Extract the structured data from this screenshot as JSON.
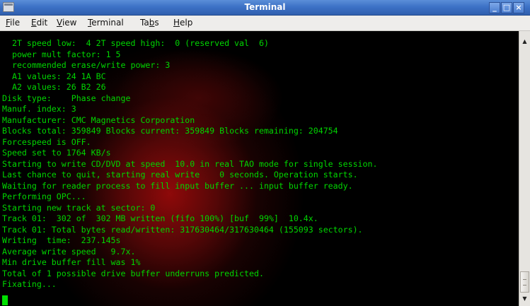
{
  "window": {
    "title": "Terminal",
    "minimize_glyph": "_",
    "maximize_glyph": "□",
    "close_glyph": "×"
  },
  "menubar": {
    "items": [
      {
        "mnemonic": "F",
        "rest": "ile"
      },
      {
        "mnemonic": "E",
        "rest": "dit"
      },
      {
        "mnemonic": "V",
        "rest": "iew"
      },
      {
        "mnemonic": "T",
        "rest": "erminal"
      },
      {
        "pre": "Ta",
        "mnemonic": "b",
        "rest": "s"
      },
      {
        "mnemonic": "H",
        "rest": "elp"
      }
    ]
  },
  "terminal": {
    "lines": [
      "  2T speed low:  4 2T speed high:  0 (reserved val  6)",
      "  power mult factor: 1 5",
      "  recommended erase/write power: 3",
      "  A1 values: 24 1A BC",
      "  A2 values: 26 B2 26",
      "Disk type:    Phase change",
      "Manuf. index: 3",
      "Manufacturer: CMC Magnetics Corporation",
      "Blocks total: 359849 Blocks current: 359849 Blocks remaining: 204754",
      "Forcespeed is OFF.",
      "Speed set to 1764 KB/s",
      "Starting to write CD/DVD at speed  10.0 in real TAO mode for single session.",
      "Last chance to quit, starting real write    0 seconds. Operation starts.",
      "Waiting for reader process to fill input buffer ... input buffer ready.",
      "Performing OPC...",
      "Starting new track at sector: 0",
      "Track 01:  302 of  302 MB written (fifo 100%) [buf  99%]  10.4x.",
      "Track 01: Total bytes read/written: 317630464/317630464 (155093 sectors).",
      "Writing  time:  237.145s",
      "Average write speed   9.7x.",
      "Min drive buffer fill was 1%",
      "Total of 1 possible drive buffer underruns predicted.",
      "Fixating..."
    ],
    "text_color": "#00d600",
    "background_color": "#000000"
  },
  "colors": {
    "titlebar": "#3d72c6",
    "menubar": "#eeedeb"
  }
}
